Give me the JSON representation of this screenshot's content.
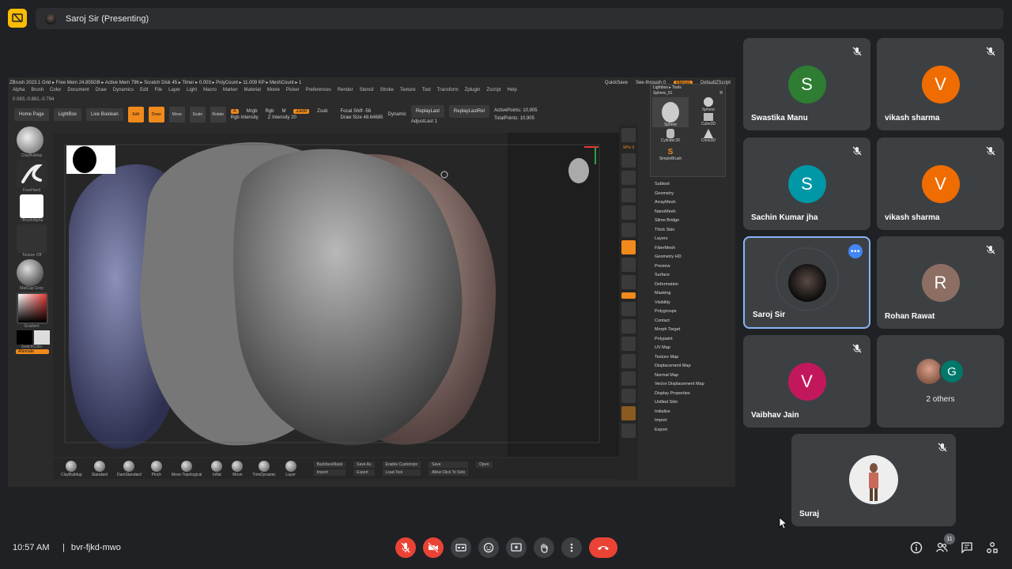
{
  "topbar": {
    "title": "Saroj Sir (Presenting)"
  },
  "zbrush": {
    "title": "ZBrush 2023.1   Grid  ▸ Free Mem 24.855GB ▸ Active Mem 796 ▸ Scratch Disk 45 ▸ Timer ▸ 0.003 ▸ PolyCount ▸ 11.009 KP ▸ MeshCount ▸ 1",
    "quicksave": "QuickSave",
    "see_through": "See-through  0",
    "menus_label": "Menus",
    "default_script": "DefaultZScript",
    "menu_items": [
      "Alpha",
      "Brush",
      "Color",
      "Document",
      "Draw",
      "Dynamics",
      "Edit",
      "File",
      "Layer",
      "Light",
      "Macro",
      "Marker",
      "Material",
      "Movie",
      "Picker",
      "Preferences",
      "Render",
      "Stencil",
      "Stroke",
      "Texture",
      "Tool",
      "Transform",
      "Zplugin",
      "Zscript",
      "Help"
    ],
    "coords": "0.083,-0.881,-0.794",
    "home_page": "Home Page",
    "lightbox": "LightBox",
    "live_boolean": "Live Boolean",
    "tools": [
      "Edit",
      "Draw",
      "Move",
      "Scale",
      "Rotate"
    ],
    "mrgb": "Mrgb",
    "rgb": "Rgb",
    "m": "M",
    "zadd": "Zadd",
    "zsub": "Zsub",
    "rgb_intensity": "Rgb Intensity",
    "z_intensity": "Z Intensity 20",
    "focal_shift": "Focal Shift -56",
    "draw_size": "Draw Size 48.64685",
    "dynamic": "Dynamic",
    "replay_last": "ReplayLast",
    "replay_last_rel": "ReplayLastRel",
    "adjust_last": "AdjustLast 1",
    "active_points": "ActivePoints: 10,905",
    "total_points": "TotalPoints: 10,905",
    "left_labels": [
      "ClayBuildup",
      "FreeHand",
      "~BrushAlpha",
      "Texture Off",
      "MatCap Grey",
      "Gradient",
      "SwitchColor",
      "Alternate"
    ],
    "shelf_brushes": [
      "ClayBuildup",
      "Standard",
      "DamStandard",
      "Pinch",
      "Move Topological",
      "Inflat",
      "Move",
      "TrimDynamic",
      "Layer"
    ],
    "shelf_buttons": [
      "BackfaceMask",
      "Save As",
      "Enable Customize",
      "Save",
      "Open",
      "Import",
      "Export",
      "Load Tool",
      "Allow Click To Solo"
    ],
    "tool_panel_header": "Lightbox ▸ Tools",
    "tool_panel_sphere": "Sphere_51",
    "tool_panel_r": "R",
    "tool_thumbs": [
      "Sphere",
      "Sphere",
      "Cube3D",
      "Cylinder3D",
      "Cone3D",
      "SimpleBrush"
    ],
    "subtool_list": [
      "Subtool",
      "Geometry",
      "ArrayMesh",
      "NanoMesh",
      "Slime Bridge",
      "Thick Skin",
      "Layers",
      "FiberMesh",
      "Geometry HD",
      "Preview",
      "Surface",
      "Deformation",
      "Masking",
      "Visibility",
      "Polygroups",
      "Contact",
      "Morph Target",
      "Polypaint",
      "UV Map",
      "Texture Map",
      "Displacement Map",
      "Normal Map",
      "Vector Displacement Map",
      "Display Properties",
      "Unified Skin",
      "Initialize",
      "Import",
      "Export"
    ],
    "spix": "SPix 3"
  },
  "participants": [
    {
      "name": "Swastika Manu",
      "initial": "S",
      "color": "#2e7d32"
    },
    {
      "name": "vikash sharma",
      "initial": "V",
      "color": "#ef6c00"
    },
    {
      "name": "Sachin Kumar jha",
      "initial": "S",
      "color": "#0097a7"
    },
    {
      "name": "vikash sharma",
      "initial": "V",
      "color": "#ef6c00"
    },
    {
      "name": "Saroj Sir",
      "initial": "",
      "color": "#1a1a1a"
    },
    {
      "name": "Rohan Rawat",
      "initial": "R",
      "color": "#8d6e63"
    },
    {
      "name": "Vaibhav Jain",
      "initial": "V",
      "color": "#c2185b"
    },
    {
      "name": "2 others",
      "initial": "G",
      "color": "#00796b"
    },
    {
      "name": "Suraj",
      "initial": "",
      "color": "#e8e8e8"
    }
  ],
  "footer": {
    "time": "10:57 AM",
    "separator": "|",
    "meeting_code": "bvr-fjkd-mwo",
    "people_count": "11"
  }
}
